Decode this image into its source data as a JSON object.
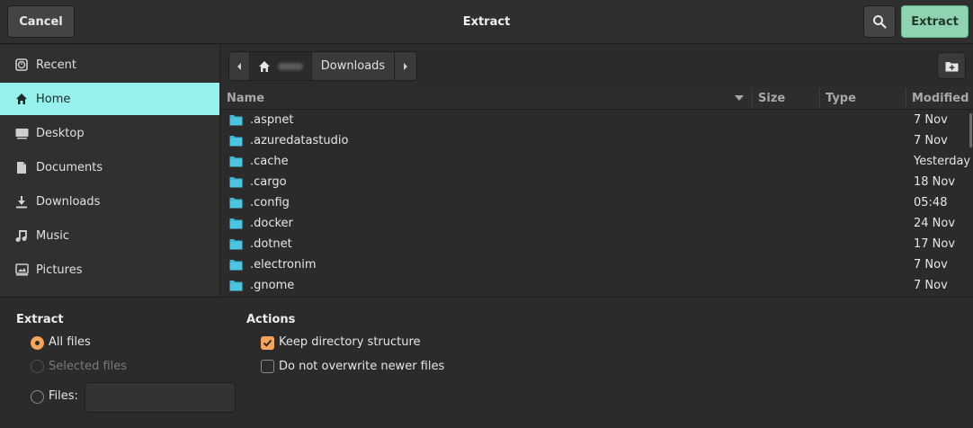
{
  "header": {
    "cancel_label": "Cancel",
    "title": "Extract",
    "search_icon": "search-icon",
    "extract_label": "Extract",
    "accent": "#8fd3b0"
  },
  "sidebar": {
    "items": [
      {
        "label": "Recent",
        "icon": "clock-icon"
      },
      {
        "label": "Home",
        "icon": "home-icon",
        "active": true
      },
      {
        "label": "Desktop",
        "icon": "desktop-icon"
      },
      {
        "label": "Documents",
        "icon": "document-icon"
      },
      {
        "label": "Downloads",
        "icon": "download-icon"
      },
      {
        "label": "Music",
        "icon": "music-icon"
      },
      {
        "label": "Pictures",
        "icon": "picture-icon"
      }
    ],
    "active_color": "#96f0ec"
  },
  "pathbar": {
    "crumbs": [
      {
        "label": "",
        "icon": "home-icon"
      },
      {
        "label": "Downloads"
      }
    ]
  },
  "filelist": {
    "columns": {
      "name": "Name",
      "size": "Size",
      "type": "Type",
      "modified": "Modified"
    },
    "folder_color": "#3fb6d3",
    "rows": [
      {
        "name": ".aspnet",
        "modified": "7 Nov"
      },
      {
        "name": ".azuredatastudio",
        "modified": "7 Nov"
      },
      {
        "name": ".cache",
        "modified": "Yesterday"
      },
      {
        "name": ".cargo",
        "modified": "18 Nov"
      },
      {
        "name": ".config",
        "modified": "05:48"
      },
      {
        "name": ".docker",
        "modified": "24 Nov"
      },
      {
        "name": ".dotnet",
        "modified": "17 Nov"
      },
      {
        "name": ".electronim",
        "modified": "7 Nov"
      },
      {
        "name": ".gnome",
        "modified": "7 Nov"
      }
    ]
  },
  "options": {
    "extract_heading": "Extract",
    "all_files": "All files",
    "selected_files": "Selected files",
    "files_label": "Files:",
    "files_value": "",
    "actions_heading": "Actions",
    "keep_structure": "Keep directory structure",
    "no_overwrite": "Do not overwrite newer files",
    "radio_color": "#f6a35b"
  }
}
